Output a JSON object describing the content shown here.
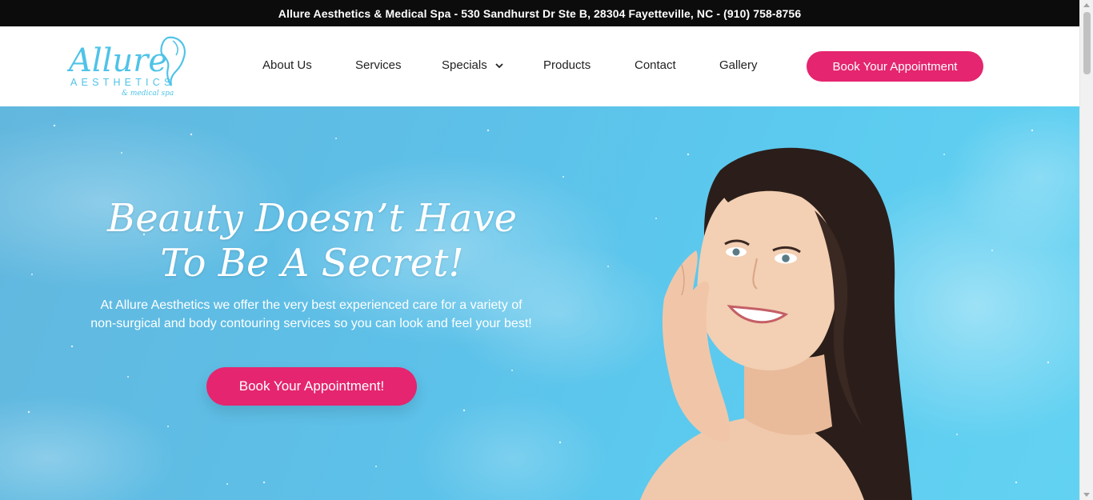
{
  "topbar": {
    "text": "Allure Aesthetics & Medical Spa - 530 Sandhurst Dr Ste B, 28304 Fayetteville, NC - (910) 758-8756"
  },
  "logo": {
    "wordmark": "Allure",
    "line1": "AESTHETICS",
    "line2": "& medical spa",
    "color": "#4fc3e8"
  },
  "nav": {
    "items": [
      {
        "label": "About Us"
      },
      {
        "label": "Services"
      },
      {
        "label": "Specials",
        "has_dropdown": true
      },
      {
        "label": "Products"
      },
      {
        "label": "Contact"
      },
      {
        "label": "Gallery"
      }
    ],
    "cta_label": "Book Your Appointment"
  },
  "hero": {
    "title_line1": "Beauty Doesn’t Have",
    "title_line2": "To Be A Secret!",
    "description": "At Allure Aesthetics we offer the very best experienced care for a variety of non-surgical and body contouring services so you can look and feel your best!",
    "cta_label": "Book Your Appointment!",
    "image": "smiling-woman-portrait"
  },
  "colors": {
    "accent": "#e5256f",
    "topbar": "#0c0c0c",
    "hero_sky": "#5cc6ec",
    "nav_text": "#222222"
  }
}
